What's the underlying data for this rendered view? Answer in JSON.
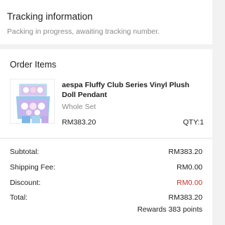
{
  "tracking": {
    "title": "Tracking information",
    "status": "Packing in progress, awaiting tracking number."
  },
  "order": {
    "title": "Order Items",
    "item": {
      "name": "aespa Fluffy Club Series Vinyl Plush Doll Pendant",
      "variant": "Whole Set",
      "price": "RM383.20",
      "qty": "QTY:1",
      "image_icon": "product-box-image"
    }
  },
  "summary": {
    "subtotal_label": "Subtotal:",
    "subtotal_value": "RM383.20",
    "shipping_label": "Shipping Fee:",
    "shipping_value": "RM0.00",
    "discount_label": "Discount:",
    "discount_value": "RM0.00",
    "discount_color": "#c0392b",
    "total_label": "Total:",
    "total_value": "RM383.20",
    "rewards": "Rewards 383 points"
  }
}
